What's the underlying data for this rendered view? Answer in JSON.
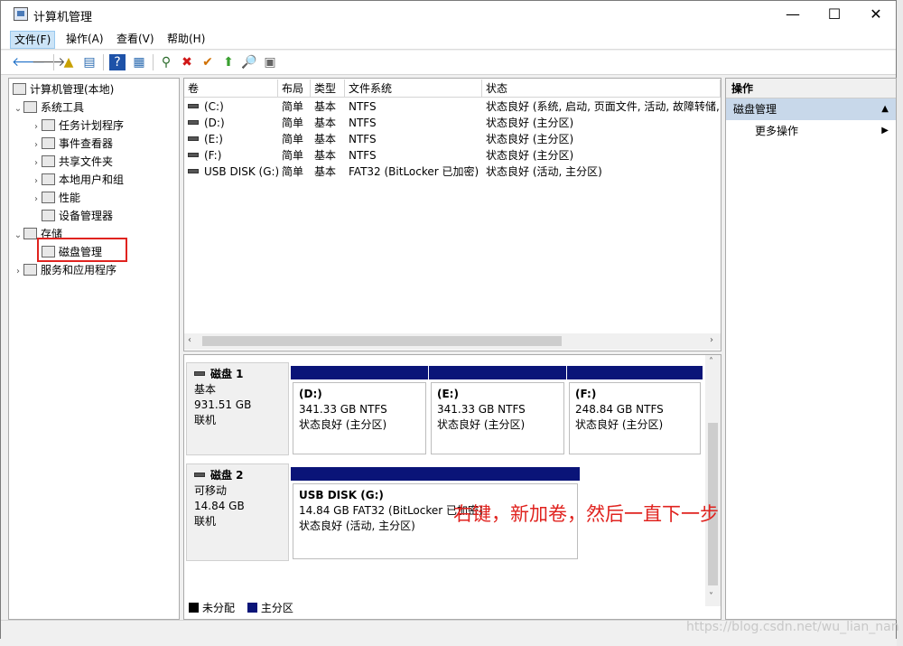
{
  "window": {
    "title": "计算机管理",
    "minimize_icon": "—",
    "maximize_icon": "☐",
    "close_icon": "✕"
  },
  "menu": [
    "文件(F)",
    "操作(A)",
    "查看(V)",
    "帮助(H)"
  ],
  "toolbar": {
    "back": "🡐",
    "forward": "🡒",
    "up": "▲",
    "props": "▤",
    "help": "?",
    "view": "▦",
    "connect": "⚲",
    "delete": "✖",
    "check": "✔",
    "arrow": "⬆",
    "search": "🔎",
    "panel": "▣"
  },
  "tree": {
    "root": "计算机管理(本地)",
    "system_tools": "系统工具",
    "task_scheduler": "任务计划程序",
    "event_viewer": "事件查看器",
    "shared_folders": "共享文件夹",
    "local_users": "本地用户和组",
    "performance": "性能",
    "device_manager": "设备管理器",
    "storage": "存储",
    "disk_management": "磁盘管理",
    "services_apps": "服务和应用程序"
  },
  "volume_list": {
    "headers": {
      "vol": "卷",
      "layout": "布局",
      "type": "类型",
      "fs": "文件系统",
      "status": "状态"
    },
    "rows": [
      {
        "vol": "(C:)",
        "layout": "简单",
        "type": "基本",
        "fs": "NTFS",
        "status": "状态良好 (系统, 启动, 页面文件, 活动, 故障转储,"
      },
      {
        "vol": "(D:)",
        "layout": "简单",
        "type": "基本",
        "fs": "NTFS",
        "status": "状态良好 (主分区)"
      },
      {
        "vol": "(E:)",
        "layout": "简单",
        "type": "基本",
        "fs": "NTFS",
        "status": "状态良好 (主分区)"
      },
      {
        "vol": "(F:)",
        "layout": "简单",
        "type": "基本",
        "fs": "NTFS",
        "status": "状态良好 (主分区)"
      },
      {
        "vol": "USB DISK (G:)",
        "layout": "简单",
        "type": "基本",
        "fs": "FAT32 (BitLocker 已加密)",
        "status": "状态良好 (活动, 主分区)"
      }
    ]
  },
  "disks": [
    {
      "name": "磁盘 1",
      "kind": "基本",
      "size": "931.51 GB",
      "state": "联机",
      "parts": [
        {
          "label": "(D:)",
          "size": "341.33 GB NTFS",
          "status": "状态良好 (主分区)"
        },
        {
          "label": "(E:)",
          "size": "341.33 GB NTFS",
          "status": "状态良好 (主分区)"
        },
        {
          "label": "(F:)",
          "size": "248.84 GB NTFS",
          "status": "状态良好 (主分区)"
        }
      ]
    },
    {
      "name": "磁盘 2",
      "kind": "可移动",
      "size": "14.84 GB",
      "state": "联机",
      "parts": [
        {
          "label": "USB DISK  (G:)",
          "size": "14.84 GB FAT32 (BitLocker 已加密)",
          "status": "状态良好 (活动, 主分区)"
        }
      ]
    }
  ],
  "legend": [
    {
      "label": "未分配",
      "color": "#000000"
    },
    {
      "label": "主分区",
      "color": "#0a1478"
    }
  ],
  "actions": {
    "header": "操作",
    "section": "磁盘管理",
    "more": "更多操作"
  },
  "annotation": "右键，新加卷，然后一直下一步",
  "watermark": "https://blog.csdn.net/wu_lian_nan",
  "colors": {
    "primary_bar": "#0a1478",
    "highlight": "#e0231f",
    "action_section": "#c8d8ea"
  }
}
